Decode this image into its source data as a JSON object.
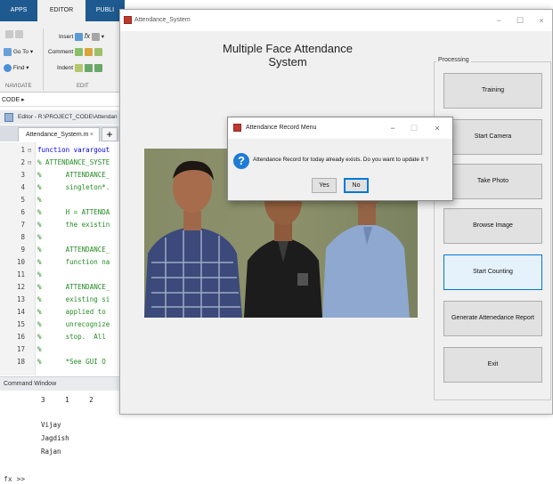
{
  "matlab": {
    "tabs": {
      "apps": "APPS",
      "editor": "EDITOR",
      "publish": "PUBLI"
    },
    "ribbon": {
      "goto": "Go To",
      "find": "Find",
      "insert": "Insert",
      "comment": "Comment",
      "indent": "Indent",
      "fx": "fx",
      "navigate": "NAVIGATE",
      "edit": "EDIT"
    },
    "path_bar": "CODE ▸",
    "editor_title": "Editor - R:\\PROJECT_CODE\\Attendan",
    "file_tab": "Attendance_System.m",
    "file_tab_close": "×",
    "new_tab": "+",
    "code_lines": [
      {
        "n": "1",
        "fold": "⊟",
        "text": "function varargout",
        "kw": true
      },
      {
        "n": "2",
        "fold": "⊟",
        "text": "% ATTENDANCE_SYSTE",
        "kw": false
      },
      {
        "n": "3",
        "fold": "",
        "text": "%      ATTENDANCE_",
        "kw": false
      },
      {
        "n": "4",
        "fold": "",
        "text": "%      singleton*.",
        "kw": false
      },
      {
        "n": "5",
        "fold": "",
        "text": "%",
        "kw": false
      },
      {
        "n": "6",
        "fold": "",
        "text": "%      H = ATTENDA",
        "kw": false
      },
      {
        "n": "7",
        "fold": "",
        "text": "%      the existin",
        "kw": false
      },
      {
        "n": "8",
        "fold": "",
        "text": "%",
        "kw": false
      },
      {
        "n": "9",
        "fold": "",
        "text": "%      ATTENDANCE_",
        "kw": false
      },
      {
        "n": "10",
        "fold": "",
        "text": "%      function na",
        "kw": false
      },
      {
        "n": "11",
        "fold": "",
        "text": "%",
        "kw": false
      },
      {
        "n": "12",
        "fold": "",
        "text": "%      ATTENDANCE_",
        "kw": false
      },
      {
        "n": "13",
        "fold": "",
        "text": "%      existing si",
        "kw": false
      },
      {
        "n": "14",
        "fold": "",
        "text": "%      applied to ",
        "kw": false
      },
      {
        "n": "15",
        "fold": "",
        "text": "%      unrecognize",
        "kw": false
      },
      {
        "n": "16",
        "fold": "",
        "text": "%      stop.  All ",
        "kw": false
      },
      {
        "n": "17",
        "fold": "",
        "text": "%",
        "kw": false
      },
      {
        "n": "18",
        "fold": "",
        "text": "%      *See GUI O",
        "kw": false
      }
    ],
    "command_window_title": "Command Window",
    "command_output": [
      "3     1     2",
      "",
      "",
      "Vijay",
      "Jagdish",
      "Rajan"
    ],
    "prompt": "fx >>"
  },
  "app": {
    "window_title": "Attendance_System",
    "minimize": "−",
    "maximize": "☐",
    "close": "×",
    "heading": "Multiple Face Attendance System",
    "panel_title": "Processing",
    "buttons": [
      "Training",
      "Start Camera",
      "Take Photo",
      "Browse Image",
      "Start Counting",
      "Generate Attenedance Report",
      "Exit"
    ]
  },
  "dialog": {
    "title": "Attendance Record Menu",
    "minimize": "−",
    "maximize": "☐",
    "close": "×",
    "icon": "question-icon",
    "message": "Attendance Record for today already exists. Do you want to update it ?",
    "yes": "Yes",
    "no": "No"
  },
  "colors": {
    "matlab_tab_bar": "#1e5a8f",
    "question_icon": "#1e7bd6",
    "focus_border": "#0078d7",
    "button_face": "#e1e1e1"
  }
}
